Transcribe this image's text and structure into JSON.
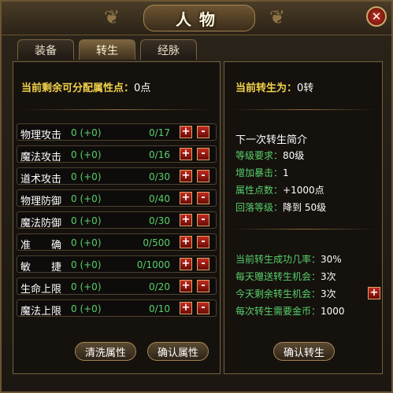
{
  "window": {
    "title": "人物",
    "close_icon": "close-icon"
  },
  "tabs": [
    {
      "label": "装备",
      "active": false
    },
    {
      "label": "转生",
      "active": true
    },
    {
      "label": "经脉",
      "active": false
    }
  ],
  "left": {
    "points_label": "当前剩余可分配属性点：",
    "points_value": "0点",
    "attributes": [
      {
        "name": "物理攻击",
        "value": "0 (+0)",
        "max": "0/17"
      },
      {
        "name": "魔法攻击",
        "value": "0 (+0)",
        "max": "0/16"
      },
      {
        "name": "道术攻击",
        "value": "0 (+0)",
        "max": "0/30"
      },
      {
        "name": "物理防御",
        "value": "0 (+0)",
        "max": "0/40"
      },
      {
        "name": "魔法防御",
        "value": "0 (+0)",
        "max": "0/30"
      },
      {
        "name": "准　　确",
        "value": "0 (+0)",
        "max": "0/500"
      },
      {
        "name": "敏　　捷",
        "value": "0 (+0)",
        "max": "0/1000"
      },
      {
        "name": "生命上限",
        "value": "0 (+0)",
        "max": "0/20"
      },
      {
        "name": "魔法上限",
        "value": "0 (+0)",
        "max": "0/10"
      }
    ],
    "plus": "+",
    "minus": "-",
    "reset_button": "清洗属性",
    "confirm_button": "确认属性"
  },
  "right": {
    "rebirth_label": "当前转生为：",
    "rebirth_value": "0转",
    "next_title": "下一次转生简介",
    "next": [
      {
        "label": "等级要求：",
        "value": "80级"
      },
      {
        "label": "增加暴击：",
        "value": "1"
      },
      {
        "label": "属性点数：",
        "value": "+1000点"
      },
      {
        "label": "回落等级：",
        "value": "降到 50级"
      }
    ],
    "stats": [
      {
        "label": "当前转生成功几率：",
        "value": "30%"
      },
      {
        "label": "每天赠送转生机会：",
        "value": "3次"
      },
      {
        "label": "今天剩余转生机会：",
        "value": "3次"
      },
      {
        "label": "每次转生需要金币：",
        "value": "1000"
      }
    ],
    "add_chance_button": "+",
    "confirm_button": "确认转生"
  },
  "colors": {
    "gold": "#f2d24a",
    "green": "#58d06b",
    "red": "#c22a1e",
    "border": "#76603c"
  }
}
